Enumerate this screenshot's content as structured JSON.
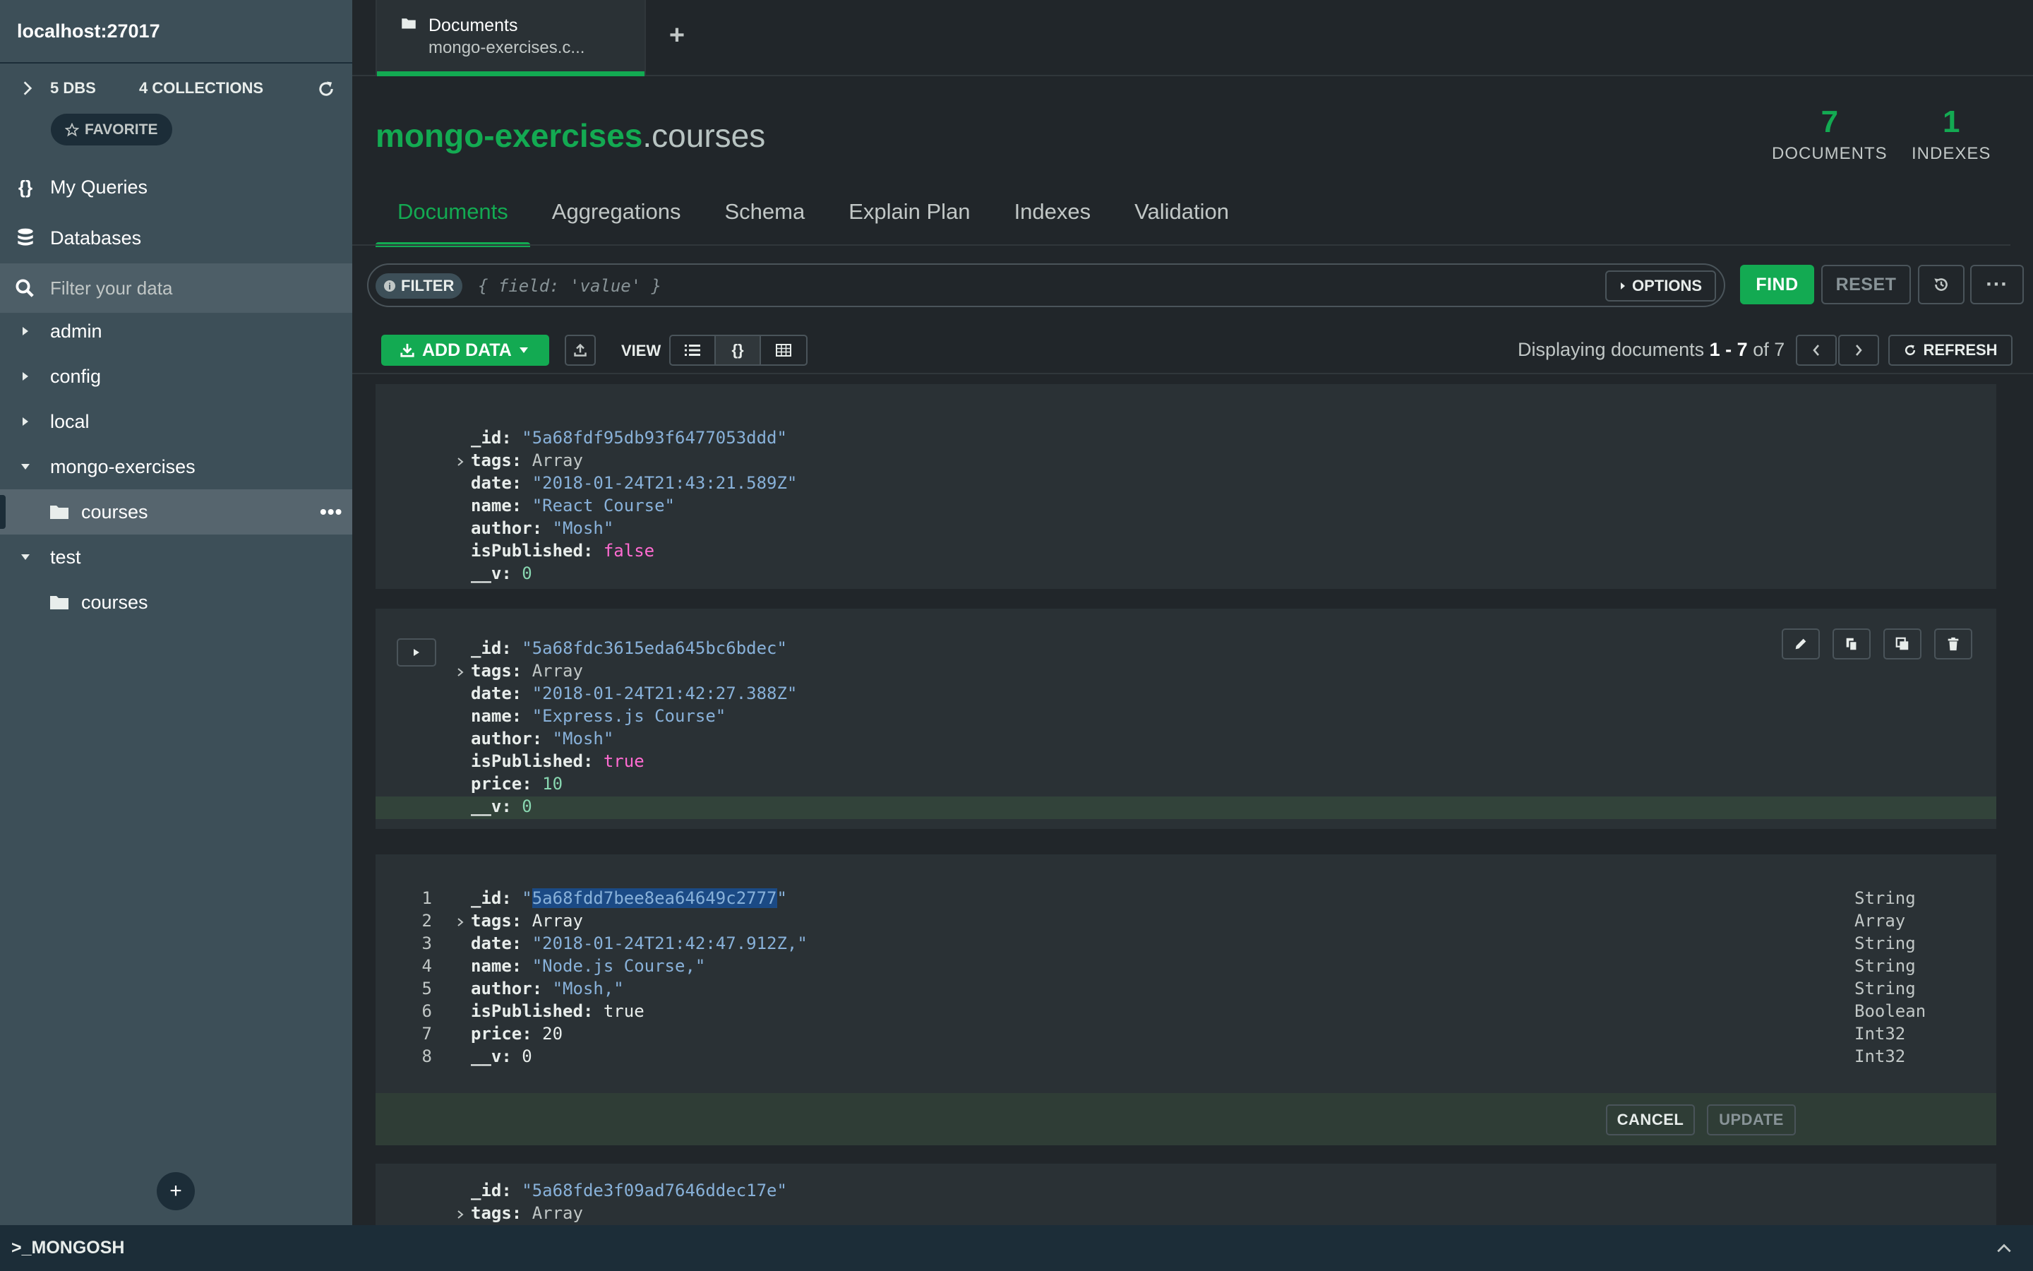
{
  "sidebar": {
    "connection": "localhost:27017",
    "dbs_count": "5 DBS",
    "collections_count": "4 COLLECTIONS",
    "favorite_label": "FAVORITE",
    "nav": [
      {
        "label": "My Queries",
        "icon": "braces-icon"
      },
      {
        "label": "Databases",
        "icon": "database-icon"
      }
    ],
    "filter_placeholder": "Filter your data",
    "tree": [
      {
        "label": "admin",
        "type": "db",
        "expanded": false
      },
      {
        "label": "config",
        "type": "db",
        "expanded": false
      },
      {
        "label": "local",
        "type": "db",
        "expanded": false
      },
      {
        "label": "mongo-exercises",
        "type": "db",
        "expanded": true
      },
      {
        "label": "courses",
        "type": "collection",
        "active": true
      },
      {
        "label": "test",
        "type": "db",
        "expanded": true
      },
      {
        "label": "courses",
        "type": "collection",
        "active": false
      }
    ]
  },
  "tab": {
    "title": "Documents",
    "subtitle": "mongo-exercises.c..."
  },
  "header": {
    "db": "mongo-exercises",
    "collection": ".courses",
    "documents_count": "7",
    "documents_label": "DOCUMENTS",
    "indexes_count": "1",
    "indexes_label": "INDEXES",
    "tabs": [
      "Documents",
      "Aggregations",
      "Schema",
      "Explain Plan",
      "Indexes",
      "Validation"
    ]
  },
  "query": {
    "filter_label": "FILTER",
    "placeholder": "{ field: 'value' }",
    "options_label": "OPTIONS",
    "find_label": "FIND",
    "reset_label": "RESET"
  },
  "toolbar": {
    "add_data_label": "ADD DATA",
    "view_label": "VIEW",
    "display_prefix": "Displaying documents",
    "display_range": "1 - 7",
    "display_of": "of 7",
    "refresh_label": "REFRESH"
  },
  "documents": [
    {
      "fields": [
        {
          "key": "_id",
          "value": "\"5a68fdf95db93f6477053ddd\"",
          "kind": "s"
        },
        {
          "key": "tags",
          "value": "Array",
          "kind": "ar",
          "expand": true
        },
        {
          "key": "date",
          "value": "\"2018-01-24T21:43:21.589Z\"",
          "kind": "s"
        },
        {
          "key": "name",
          "value": "\"React Course\"",
          "kind": "s"
        },
        {
          "key": "author",
          "value": "\"Mosh\"",
          "kind": "s"
        },
        {
          "key": "isPublished",
          "value": "false",
          "kind": "bf"
        },
        {
          "key": "__v",
          "value": "0",
          "kind": "n"
        }
      ]
    },
    {
      "fields": [
        {
          "key": "_id",
          "value": "\"5a68fdc3615eda645bc6bdec\"",
          "kind": "s"
        },
        {
          "key": "tags",
          "value": "Array",
          "kind": "ar",
          "expand": true
        },
        {
          "key": "date",
          "value": "\"2018-01-24T21:42:27.388Z\"",
          "kind": "s"
        },
        {
          "key": "name",
          "value": "\"Express.js Course\"",
          "kind": "s"
        },
        {
          "key": "author",
          "value": "\"Mosh\"",
          "kind": "s"
        },
        {
          "key": "isPublished",
          "value": "true",
          "kind": "bf"
        },
        {
          "key": "price",
          "value": "10",
          "kind": "n"
        },
        {
          "key": "__v",
          "value": "0",
          "kind": "n"
        }
      ]
    },
    {
      "editing": true,
      "fields": [
        {
          "ln": "1",
          "key": "_id",
          "pre": "\"",
          "hl": "5a68fdd7bee8ea64649c2777",
          "post": "\"",
          "type": "String"
        },
        {
          "ln": "2",
          "key": "tags",
          "plain": "Array",
          "type": "Array",
          "expand": true
        },
        {
          "ln": "3",
          "key": "date",
          "plain": "\"2018-01-24T21:42:47.912Z,\"",
          "type": "String"
        },
        {
          "ln": "4",
          "key": "name",
          "plain": "\"Node.js Course,\"",
          "type": "String"
        },
        {
          "ln": "5",
          "key": "author",
          "plain": "\"Mosh,\"",
          "type": "String"
        },
        {
          "ln": "6",
          "key": "isPublished",
          "plain": "true",
          "type": "Boolean"
        },
        {
          "ln": "7",
          "key": "price",
          "plain": "20",
          "type": "Int32"
        },
        {
          "ln": "8",
          "key": "__v",
          "plain": "0",
          "type": "Int32"
        }
      ],
      "cancel_label": "CANCEL",
      "update_label": "UPDATE"
    },
    {
      "fields": [
        {
          "key": "_id",
          "value": "\"5a68fde3f09ad7646ddec17e\"",
          "kind": "s"
        },
        {
          "key": "tags",
          "value": "Array",
          "kind": "ar",
          "expand": true
        }
      ]
    }
  ],
  "mongosh_label": ">_MONGOSH"
}
